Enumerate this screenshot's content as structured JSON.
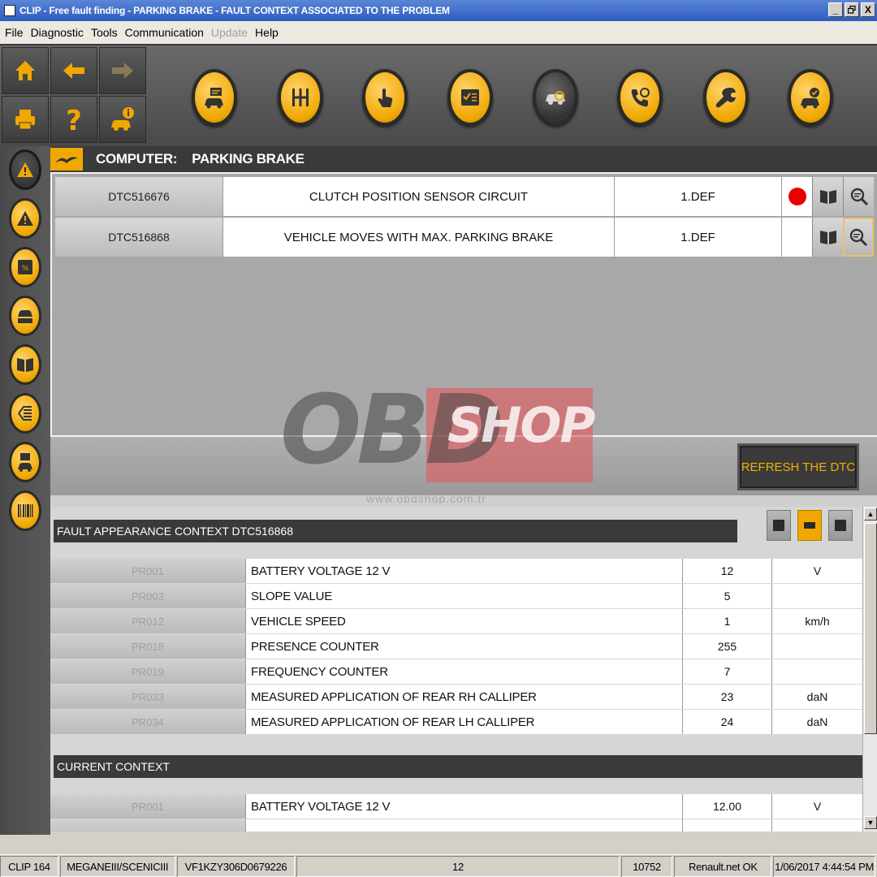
{
  "window": {
    "title": "CLIP - Free fault finding - PARKING BRAKE - FAULT CONTEXT ASSOCIATED TO THE PROBLEM",
    "controls": {
      "minimize": "_",
      "restore": "̸",
      "close": "X"
    }
  },
  "menu": {
    "items": [
      {
        "label": "File",
        "enabled": true
      },
      {
        "label": "Diagnostic",
        "enabled": true
      },
      {
        "label": "Tools",
        "enabled": true
      },
      {
        "label": "Communication",
        "enabled": true
      },
      {
        "label": "Update",
        "enabled": false
      },
      {
        "label": "Help",
        "enabled": true
      }
    ]
  },
  "toolbar": {
    "nav_icons": [
      "home-icon",
      "back-arrow-icon",
      "forward-arrow-icon",
      "print-icon",
      "help-icon",
      "vehicle-info-icon"
    ],
    "round_icons": [
      "vehicle-identification-icon",
      "gearbox-icon",
      "touch-test-icon",
      "checklist-icon",
      "fault-finding-icon",
      "phone-support-icon",
      "wrench-icon",
      "vehicle-ok-icon"
    ],
    "active_round": "fault-finding-icon"
  },
  "sidebar": {
    "icons": [
      "warning-active-icon",
      "warning-icon",
      "parameters-icon",
      "vehicle-states-icon",
      "documentation-icon",
      "tree-icon",
      "save-vehicle-icon",
      "barcode-icon"
    ]
  },
  "computer": {
    "label": "COMPUTER:",
    "value": "PARKING BRAKE"
  },
  "dtcs": [
    {
      "code": "DTC516676",
      "description": "CLUTCH POSITION SENSOR CIRCUIT",
      "status": "1.DEF",
      "present": true
    },
    {
      "code": "DTC516868",
      "description": "VEHICLE MOVES WITH MAX. PARKING BRAKE",
      "status": "1.DEF",
      "present": false
    }
  ],
  "refresh_button": "REFRESH THE DTC",
  "watermark": {
    "brand_a": "OBD",
    "brand_b": "SHOP",
    "url": "www.obdshop.com.tr"
  },
  "fault_context": {
    "title": "FAULT APPEARANCE CONTEXT DTC516868",
    "rows": [
      {
        "code": "PR001",
        "name": "BATTERY VOLTAGE 12 V",
        "value": "12",
        "unit": "V"
      },
      {
        "code": "PR003",
        "name": "SLOPE VALUE",
        "value": "5",
        "unit": ""
      },
      {
        "code": "PR012",
        "name": "VEHICLE SPEED",
        "value": "1",
        "unit": "km/h"
      },
      {
        "code": "PR018",
        "name": "PRESENCE COUNTER",
        "value": "255",
        "unit": ""
      },
      {
        "code": "PR019",
        "name": "FREQUENCY COUNTER",
        "value": "7",
        "unit": ""
      },
      {
        "code": "PR033",
        "name": "MEASURED APPLICATION OF REAR RH CALLIPER",
        "value": "23",
        "unit": "daN"
      },
      {
        "code": "PR034",
        "name": "MEASURED APPLICATION OF REAR LH CALLIPER",
        "value": "24",
        "unit": "daN"
      }
    ]
  },
  "current_context": {
    "title": "CURRENT CONTEXT",
    "rows": [
      {
        "code": "PR001",
        "name": "BATTERY VOLTAGE 12 V",
        "value": "12.00",
        "unit": "V"
      }
    ]
  },
  "status_bar": {
    "cells": [
      "CLIP 164",
      "MEGANEIII/SCENICIII",
      "VF1KZY306D0679226",
      "12",
      "10752",
      "Renault.net OK",
      "1/06/2017 4:44:54 PM"
    ]
  },
  "colors": {
    "accent": "#f0a800",
    "header_dark": "#3a3a3a",
    "alert_red": "#e60000"
  }
}
